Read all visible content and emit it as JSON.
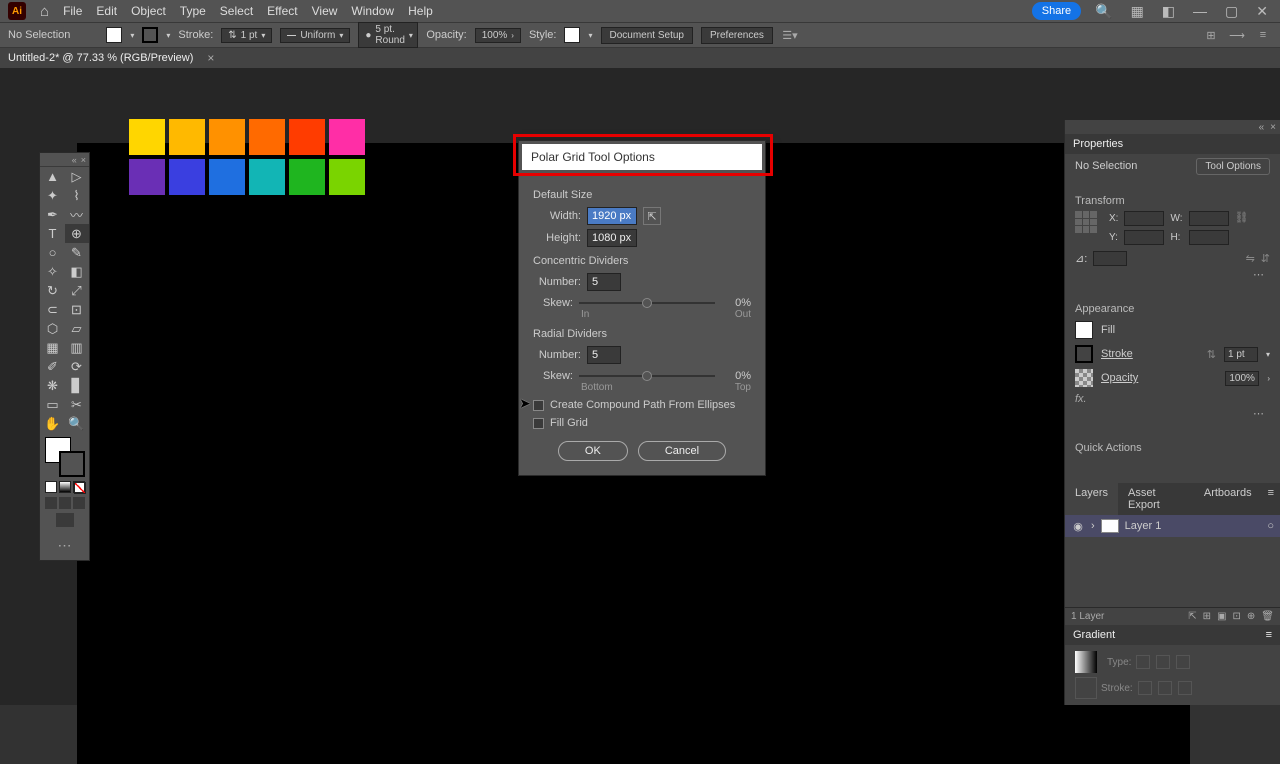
{
  "menubar": {
    "items": [
      "File",
      "Edit",
      "Object",
      "Type",
      "Select",
      "Effect",
      "View",
      "Window",
      "Help"
    ],
    "share": "Share"
  },
  "optionsbar": {
    "selection": "No Selection",
    "stroke_label": "Stroke:",
    "stroke_weight": "1 pt",
    "stroke_profile": "Uniform",
    "brush": "5 pt. Round",
    "opacity_label": "Opacity:",
    "opacity_val": "100%",
    "style_label": "Style:",
    "doc_setup": "Document Setup",
    "prefs": "Preferences"
  },
  "doctab": "Untitled-2* @ 77.33 % (RGB/Preview)",
  "swatches": {
    "row1": [
      "#ffd600",
      "#ffb900",
      "#ff9100",
      "#ff6a00",
      "#ff3c00",
      "#ff2ea6"
    ],
    "row2": [
      "#6a2fb5",
      "#3a3fe0",
      "#1f6fe0",
      "#12b5b5",
      "#1fb51f",
      "#7ad400"
    ]
  },
  "dialog": {
    "title": "Polar Grid Tool Options",
    "default_size": "Default Size",
    "width_label": "Width:",
    "width_val": "1920 px",
    "height_label": "Height:",
    "height_val": "1080 px",
    "concentric": "Concentric Dividers",
    "number_label": "Number:",
    "conc_number": "5",
    "skew_label": "Skew:",
    "conc_skew_val": "0%",
    "conc_in": "In",
    "conc_out": "Out",
    "radial": "Radial Dividers",
    "radial_number": "5",
    "radial_skew_val": "0%",
    "radial_bottom": "Bottom",
    "radial_top": "Top",
    "cb_compound": "Create Compound Path From Ellipses",
    "cb_fill": "Fill Grid",
    "ok": "OK",
    "cancel": "Cancel"
  },
  "props": {
    "title": "Properties",
    "selection": "No Selection",
    "tool_options": "Tool Options",
    "transform": "Transform",
    "x": "X:",
    "y": "Y:",
    "w": "W:",
    "h": "H:",
    "angle": "⊿:",
    "appearance": "Appearance",
    "fill": "Fill",
    "stroke": "Stroke",
    "stroke_val": "1 pt",
    "opacity": "Opacity",
    "opacity_val": "100%",
    "fx": "fx.",
    "quick": "Quick Actions"
  },
  "layers": {
    "tabs": [
      "Layers",
      "Asset Export",
      "Artboards"
    ],
    "layer1": "Layer 1",
    "count": "1 Layer"
  },
  "gradient": {
    "title": "Gradient",
    "type": "Type:",
    "stroke": "Stroke:"
  }
}
